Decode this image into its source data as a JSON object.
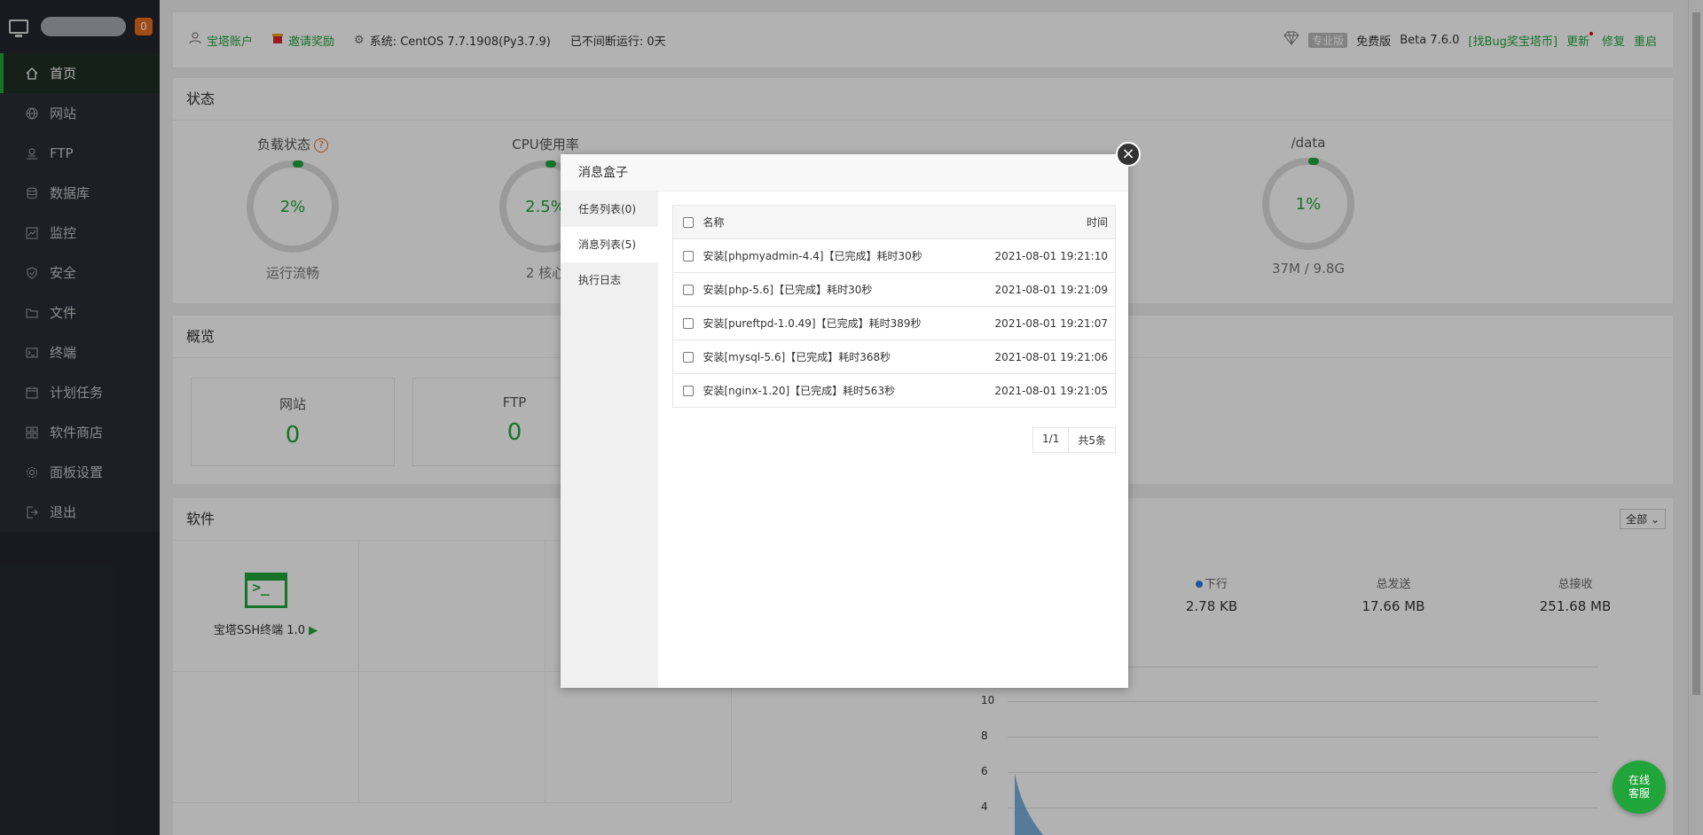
{
  "sidebar": {
    "badge": "0",
    "items": [
      {
        "label": "首页",
        "icon": "home-icon"
      },
      {
        "label": "网站",
        "icon": "globe-icon"
      },
      {
        "label": "FTP",
        "icon": "ftp-icon"
      },
      {
        "label": "数据库",
        "icon": "database-icon"
      },
      {
        "label": "监控",
        "icon": "monitor-icon"
      },
      {
        "label": "安全",
        "icon": "shield-icon"
      },
      {
        "label": "文件",
        "icon": "folder-icon"
      },
      {
        "label": "终端",
        "icon": "terminal-icon"
      },
      {
        "label": "计划任务",
        "icon": "calendar-icon"
      },
      {
        "label": "软件商店",
        "icon": "grid-icon"
      },
      {
        "label": "面板设置",
        "icon": "gear-icon"
      },
      {
        "label": "退出",
        "icon": "logout-icon"
      }
    ]
  },
  "topbar": {
    "account": "宝塔账户",
    "invite": "邀请奖励",
    "system": "系统:  CentOS 7.7.1908(Py3.7.9)",
    "uptime": "已不间断运行: 0天",
    "pro": "专业版",
    "free": "免费版",
    "version": "Beta  7.6.0",
    "bug": "[找Bug奖宝塔币]",
    "update": "更新",
    "repair": "修复",
    "restart": "重启"
  },
  "status": {
    "title": "状态",
    "gauges": [
      {
        "label": "负载状态",
        "value": "2%",
        "sub": "运行流畅"
      },
      {
        "label": "CPU使用率",
        "value": "2.5%",
        "sub": "2 核心"
      },
      {
        "label": "/data",
        "value": "1%",
        "sub": "37M / 9.8G"
      }
    ]
  },
  "overview": {
    "title": "概览",
    "boxes": [
      {
        "label": "网站",
        "value": "0"
      },
      {
        "label": "FTP",
        "value": "0"
      }
    ]
  },
  "software": {
    "title": "软件",
    "item": "宝塔SSH终端 1.0",
    "play": "▶"
  },
  "traffic": {
    "select": "全部",
    "cols": [
      {
        "label": "下行",
        "value": "2.78 KB"
      },
      {
        "label": "总发送",
        "value": "17.66 MB"
      },
      {
        "label": "总接收",
        "value": "251.68 MB"
      }
    ],
    "yticks": [
      "10",
      "8",
      "6",
      "4"
    ]
  },
  "modal": {
    "title": "消息盒子",
    "close": "×",
    "tabs": [
      "任务列表(0)",
      "消息列表(5)",
      "执行日志"
    ],
    "table": {
      "headers": [
        "名称",
        "时间"
      ],
      "rows": [
        {
          "name": "安装[phpmyadmin-4.4]【已完成】耗时30秒",
          "time": "2021-08-01 19:21:10"
        },
        {
          "name": "安装[php-5.6]【已完成】耗时30秒",
          "time": "2021-08-01 19:21:09"
        },
        {
          "name": "安装[pureftpd-1.0.49]【已完成】耗时389秒",
          "time": "2021-08-01 19:21:07"
        },
        {
          "name": "安装[mysql-5.6]【已完成】耗时368秒",
          "time": "2021-08-01 19:21:06"
        },
        {
          "name": "安装[nginx-1.20]【已完成】耗时563秒",
          "time": "2021-08-01 19:21:05"
        }
      ]
    },
    "pager": {
      "page": "1/1",
      "total": "共5条"
    }
  },
  "kefu": {
    "line1": "在线",
    "line2": "客服"
  }
}
